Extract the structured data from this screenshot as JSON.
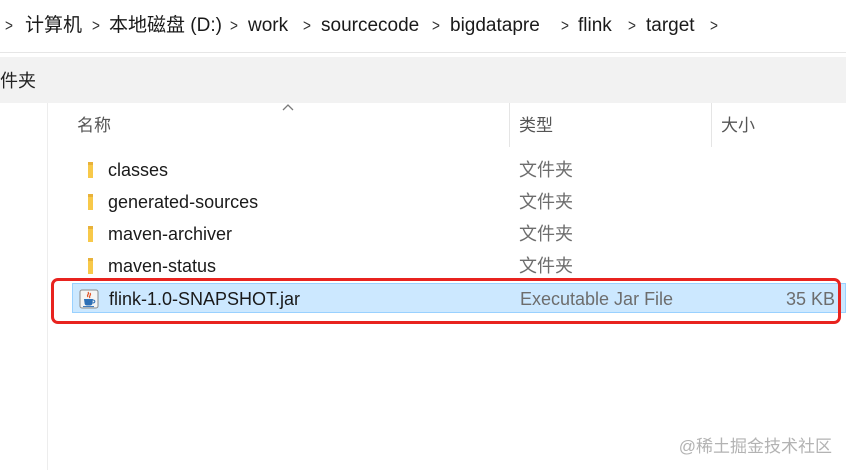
{
  "breadcrumb": {
    "items": [
      "计算机",
      "本地磁盘 (D:)",
      "work",
      "sourcecode",
      "bigdatapre",
      "flink",
      "target"
    ]
  },
  "toolbar": {
    "partial_text": "件夹"
  },
  "columns": {
    "name": "名称",
    "type": "类型",
    "size": "大小"
  },
  "files": [
    {
      "name": "classes",
      "type": "文件夹",
      "size": "",
      "icon": "folder-icon"
    },
    {
      "name": "generated-sources",
      "type": "文件夹",
      "size": "",
      "icon": "folder-icon"
    },
    {
      "name": "maven-archiver",
      "type": "文件夹",
      "size": "",
      "icon": "folder-icon"
    },
    {
      "name": "maven-status",
      "type": "文件夹",
      "size": "",
      "icon": "folder-icon"
    },
    {
      "name": "flink-1.0-SNAPSHOT.jar",
      "type": "Executable Jar File",
      "size": "35 KB",
      "icon": "java-jar-icon",
      "selected": true
    }
  ],
  "colors": {
    "selection_fill": "#cce8ff",
    "selection_border": "#99d1ff",
    "annotation_red": "#e8231f",
    "folder_yellow": "#f8c94a"
  },
  "watermark": "@稀土掘金技术社区"
}
